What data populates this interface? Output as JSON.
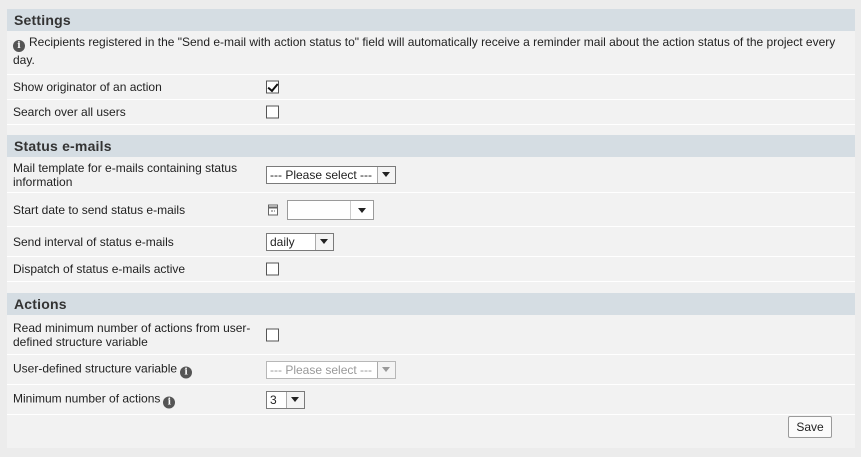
{
  "settings": {
    "header": "Settings",
    "info": "Recipients registered in the \"Send e-mail with action status to\" field will automatically receive a reminder mail about the action status of the project every day.",
    "show_originator": {
      "label": "Show originator of an action",
      "checked": true
    },
    "search_all_users": {
      "label": "Search over all users",
      "checked": false
    }
  },
  "status_emails": {
    "header": "Status e-mails",
    "mail_template": {
      "label": "Mail template for e-mails containing status information",
      "value": "--- Please select ---"
    },
    "start_date": {
      "label": "Start date to send status e-mails",
      "value": ""
    },
    "send_interval": {
      "label": "Send interval of status e-mails",
      "value": "daily"
    },
    "dispatch_active": {
      "label": "Dispatch of status e-mails active",
      "checked": false
    }
  },
  "actions": {
    "header": "Actions",
    "read_min": {
      "label": "Read minimum number of actions from user-defined structure variable",
      "checked": false
    },
    "structure_variable": {
      "label": "User-defined structure variable",
      "value": "--- Please select ---",
      "disabled": true
    },
    "min_actions": {
      "label": "Minimum number of actions",
      "value": "3"
    }
  },
  "buttons": {
    "save": "Save"
  },
  "icons": {
    "info": "info-icon",
    "calendar": "calendar-icon",
    "dropdown": "chevron-down-icon"
  }
}
